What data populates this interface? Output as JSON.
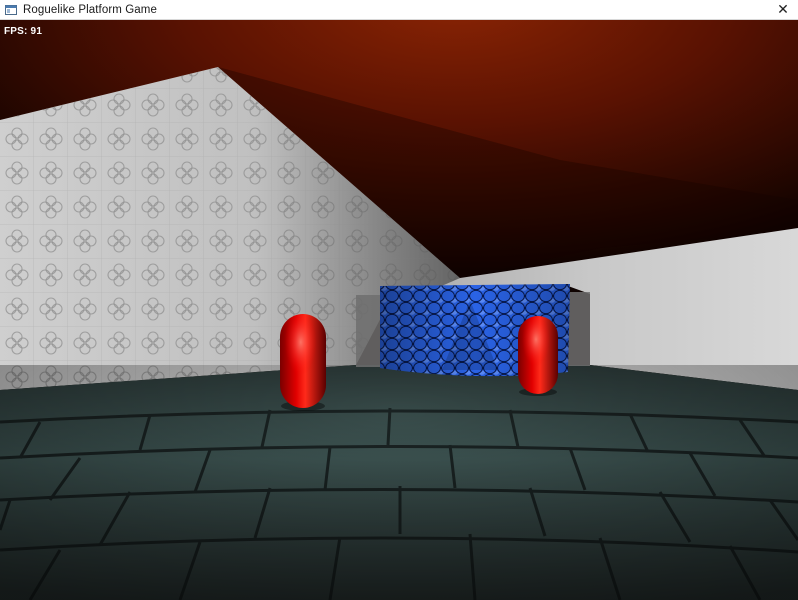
{
  "window": {
    "title": "Roguelike Platform Game",
    "close_glyph": "✕",
    "app_icon": "window-icon",
    "close_icon": "close-icon"
  },
  "hud": {
    "fps_label": "FPS: 91"
  },
  "scene": {
    "ceiling_color": "#7a1a04",
    "left_wall_color": "#cfcfcf",
    "right_wall_color": "#d2d2d2",
    "floor_color": "#3f5553",
    "block_color": "#1f4fd6",
    "pill_color": "#d40000"
  }
}
